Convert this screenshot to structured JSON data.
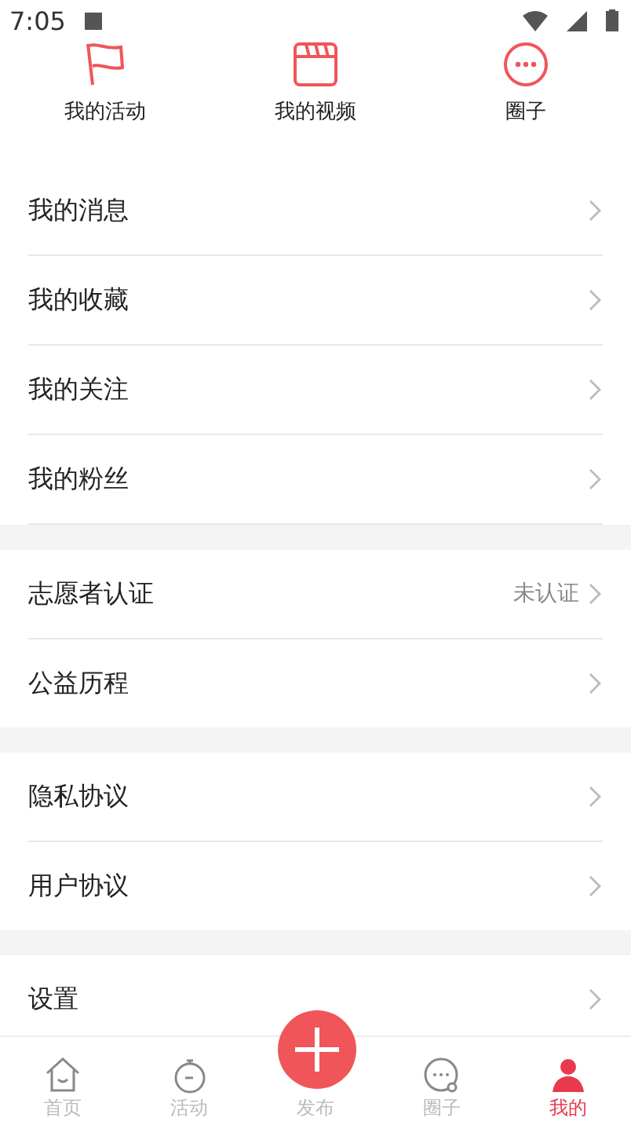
{
  "status_bar": {
    "time": "7:05"
  },
  "quick_links": [
    {
      "label": "我的活动"
    },
    {
      "label": "我的视频"
    },
    {
      "label": "圈子"
    }
  ],
  "sections": [
    {
      "rows": [
        {
          "label": "我的消息"
        },
        {
          "label": "我的收藏"
        },
        {
          "label": "我的关注"
        },
        {
          "label": "我的粉丝"
        }
      ]
    },
    {
      "rows": [
        {
          "label": "志愿者认证",
          "value": "未认证"
        },
        {
          "label": "公益历程"
        }
      ]
    },
    {
      "rows": [
        {
          "label": "隐私协议"
        },
        {
          "label": "用户协议"
        }
      ]
    },
    {
      "rows": [
        {
          "label": "设置"
        }
      ]
    }
  ],
  "tab_bar": [
    {
      "label": "首页",
      "kind": "tab",
      "selected": false
    },
    {
      "label": "活动",
      "kind": "tab",
      "selected": false
    },
    {
      "label": "发布",
      "kind": "fab",
      "selected": false
    },
    {
      "label": "圈子",
      "kind": "tab",
      "selected": false
    },
    {
      "label": "我的",
      "kind": "tab",
      "selected": true
    }
  ]
}
